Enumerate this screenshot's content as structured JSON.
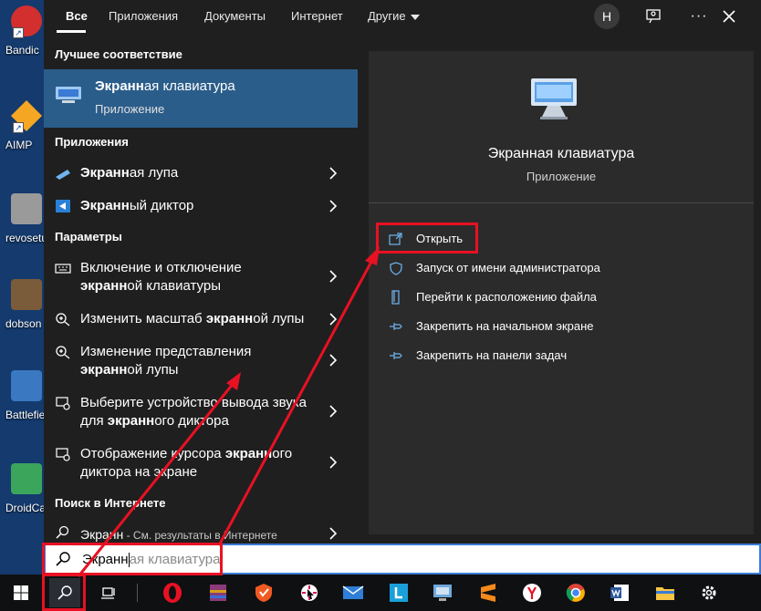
{
  "desktop": {
    "icons": [
      {
        "label": "Bandic",
        "color": "#d32f2f"
      },
      {
        "label": "AIMP",
        "color": "#f5a623"
      },
      {
        "label": "revosetu",
        "color": "#b0b0b0"
      },
      {
        "label": "dobson",
        "color": "#7a5c3b"
      },
      {
        "label": "Battlefie",
        "color": "#3a78c2"
      },
      {
        "label": "DroidCa",
        "color": "#3ba55c"
      }
    ]
  },
  "tabs": {
    "all": "Все",
    "apps": "Приложения",
    "docs": "Документы",
    "web": "Интернет",
    "more": "Другие"
  },
  "header": {
    "avatar": "Н"
  },
  "left": {
    "best_section": "Лучшее соответствие",
    "best": {
      "title_bold": "Экранн",
      "title_rest": "ая клавиатура",
      "subtitle": "Приложение"
    },
    "apps_section": "Приложения",
    "apps": [
      {
        "bold": "Экранн",
        "rest": "ая лупа"
      },
      {
        "bold": "Экранн",
        "rest": "ый диктор"
      }
    ],
    "settings_section": "Параметры",
    "settings": [
      {
        "line1": "Включение и отключение",
        "bold2": "экранн",
        "rest2": "ой клавиатуры"
      },
      {
        "pre": "Изменить масштаб ",
        "bold": "экранн",
        "post": "ой лупы"
      },
      {
        "line1": "Изменение представления",
        "bold2": "экранн",
        "rest2": "ой лупы"
      },
      {
        "line1": "Выберите устройство вывода звука",
        "pre2": "для ",
        "bold2": "экранн",
        "rest2": "ого диктора"
      },
      {
        "pre1": "Отображение курсора ",
        "bold1": "экранн",
        "rest1": "ого",
        "line2": "диктора на экране"
      }
    ],
    "web_section": "Поиск в Интернете",
    "web": {
      "bold": "Экранн",
      "rest": " - См. результаты в Интернете"
    }
  },
  "right": {
    "title": "Экранная клавиатура",
    "subtitle": "Приложение",
    "actions": [
      {
        "label": "Открыть",
        "icon": "open-icon"
      },
      {
        "label": "Запуск от имени администратора",
        "icon": "shield-icon"
      },
      {
        "label": "Перейти к расположению файла",
        "icon": "file-location-icon"
      },
      {
        "label": "Закрепить на начальном экране",
        "icon": "pin-icon"
      },
      {
        "label": "Закрепить на панели задач",
        "icon": "pin-icon"
      }
    ]
  },
  "search": {
    "typed": "Экранн",
    "suggestion": "ая клавиатура"
  },
  "taskbar": {
    "items": [
      "start-icon",
      "search-icon",
      "task-view-icon",
      "opera-icon",
      "winrar-icon",
      "avast-icon",
      "snipping-icon",
      "mail-icon",
      "l-app-icon",
      "network-icon",
      "sublime-icon",
      "yandex-icon",
      "chrome-icon",
      "word-icon",
      "explorer-icon",
      "settings-icon"
    ]
  },
  "colors": {
    "panel": "#1f1f1f",
    "preview": "#2b2b2b",
    "selected": "#2b5d8a",
    "highlight": "#e81123"
  }
}
